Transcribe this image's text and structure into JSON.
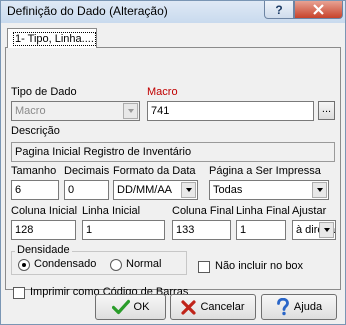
{
  "window": {
    "title": "Definição do Dado (Alteração)",
    "help_symbol": "?",
    "close_symbol": "X"
  },
  "tab": {
    "label": "1- Tipo, Linha...."
  },
  "form": {
    "tipo_dado": {
      "label": "Tipo de Dado",
      "value": "Macro"
    },
    "macro": {
      "label": "Macro",
      "value": "741",
      "button": "..."
    },
    "descricao": {
      "label": "Descrição",
      "value": "Pagina Inicial Registro de Inventário"
    },
    "tamanho": {
      "label": "Tamanho",
      "value": "6"
    },
    "decimais": {
      "label": "Decimais",
      "value": "0"
    },
    "formato_data": {
      "label": "Formato da Data",
      "value": "DD/MM/AA"
    },
    "pagina_impressa": {
      "label": "Página a Ser Impressa",
      "value": "Todas"
    },
    "coluna_inicial": {
      "label": "Coluna Inicial",
      "value": "128"
    },
    "linha_inicial": {
      "label": "Linha Inicial",
      "value": "1"
    },
    "coluna_final": {
      "label": "Coluna Final",
      "value": "133"
    },
    "linha_final": {
      "label": "Linha Final",
      "value": "1"
    },
    "ajustar": {
      "label": "Ajustar",
      "value": "à direita"
    },
    "densidade": {
      "label": "Densidade",
      "options": [
        "Condensado",
        "Normal"
      ],
      "selected": "Condensado"
    },
    "nao_incluir_box": {
      "label": "Não incluir no box",
      "checked": false
    },
    "codigo_barras": {
      "label": "Imprimir como Código de Barras",
      "checked": false
    }
  },
  "buttons": {
    "ok": "OK",
    "cancelar": "Cancelar",
    "ajuda": "Ajuda"
  },
  "colors": {
    "macro_label": "#c00000",
    "ok_icon": "#2a9d2a",
    "cancel_icon": "#c0241a",
    "help_icon": "#2a66c8"
  },
  "icons": {
    "ok": "checkmark-icon",
    "cancelar": "x-icon",
    "ajuda": "question-mark-icon"
  }
}
